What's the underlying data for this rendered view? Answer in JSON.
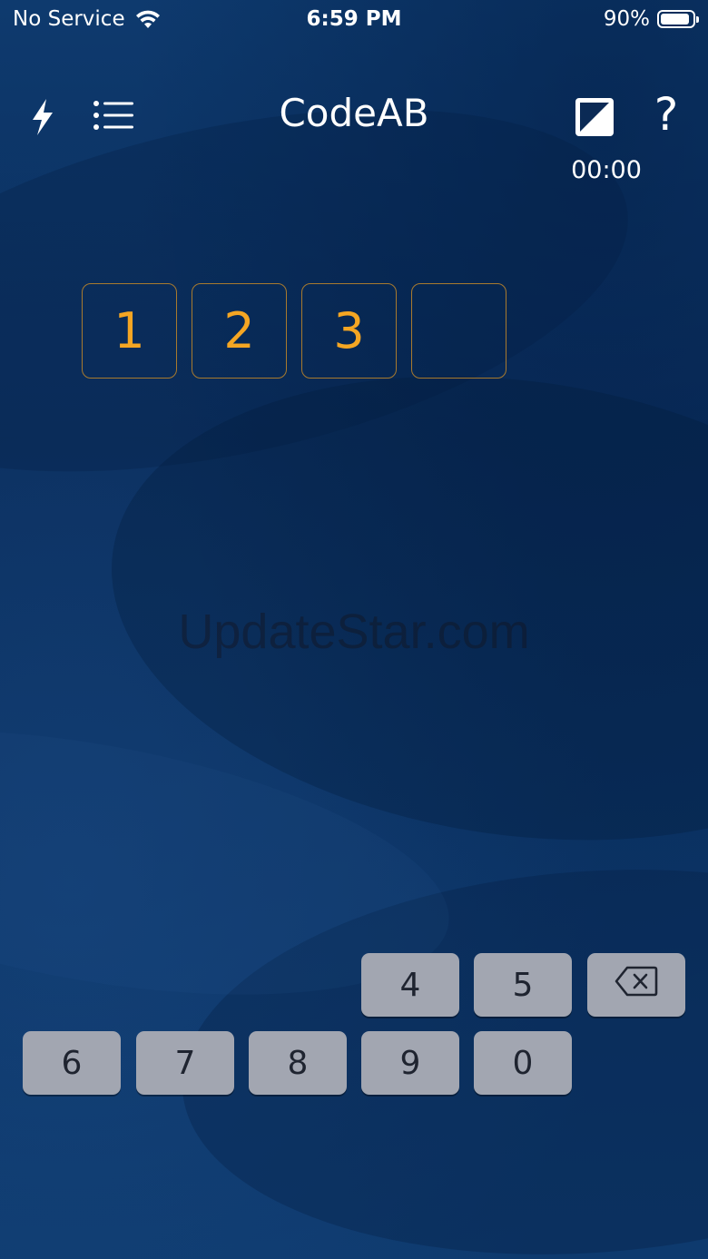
{
  "status_bar": {
    "carrier": "No Service",
    "time": "6:59 PM",
    "battery": "90%",
    "battery_level": 0.9,
    "icons": [
      "wifi-icon",
      "battery-icon"
    ]
  },
  "header": {
    "title": "CodeAB",
    "timer": "00:00",
    "help": "?",
    "icons": [
      "bolt-icon",
      "list-icon",
      "theme-toggle-icon",
      "help-icon"
    ]
  },
  "code": {
    "slots": [
      "1",
      "2",
      "3",
      ""
    ]
  },
  "watermark": "UpdateStar.com",
  "keypad": {
    "row1": [
      "4",
      "5"
    ],
    "row2": [
      "6",
      "7",
      "8",
      "9",
      "0"
    ],
    "backspace_icon": "backspace-icon"
  },
  "colors": {
    "background": "#0c315f",
    "digit": "#f5a623",
    "slot_border": "#a87a2e",
    "key": "#a2a6b1",
    "key_text": "#1f2430"
  }
}
